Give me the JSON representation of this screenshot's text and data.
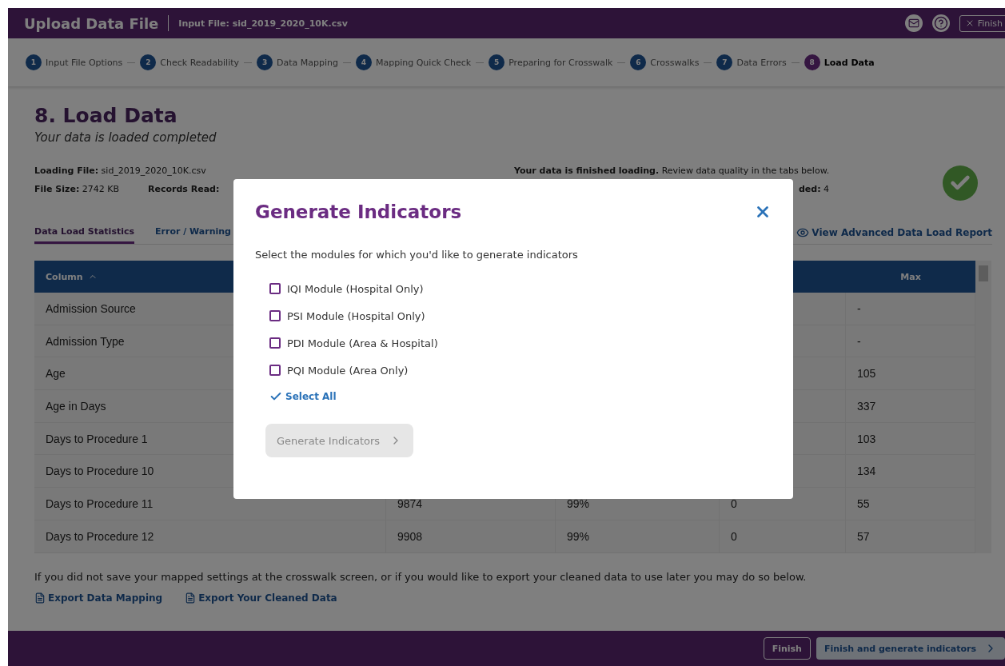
{
  "header": {
    "title": "Upload Data File",
    "input_file": "Input File: sid_2019_2020_10K.csv",
    "finish_button": "Finish"
  },
  "steps": [
    {
      "number": "1",
      "label": "Input File Options",
      "selected": false
    },
    {
      "number": "2",
      "label": "Check Readability",
      "selected": false
    },
    {
      "number": "3",
      "label": "Data Mapping",
      "selected": false
    },
    {
      "number": "4",
      "label": "Mapping Quick Check",
      "selected": false
    },
    {
      "number": "5",
      "label": "Preparing for Crosswalk",
      "selected": false
    },
    {
      "number": "6",
      "label": "Crosswalks",
      "selected": false
    },
    {
      "number": "7",
      "label": "Data Errors",
      "selected": false
    },
    {
      "number": "8",
      "label": "Load Data",
      "selected": true
    }
  ],
  "page": {
    "title": "8. Load Data",
    "subtitle": "Your data is loaded completed",
    "loading_file": "**Loading File:** sid_2019_2020_10K.csv",
    "file_size": "**File Size:** 2742 KB",
    "records_read": "**Records Read:**",
    "status_message": "**Your data is finished loading.** Review data quality in the tabs below.",
    "status_count": "**ded:** 4"
  },
  "tabs": [
    {
      "label": "Data Load Statistics",
      "selected": true
    },
    {
      "label": "Error / Warning",
      "selected": false
    }
  ],
  "report_link": "View Advanced Data Load Report",
  "table": {
    "columns": [
      {
        "label": "Column",
        "sorted": true
      },
      {
        "label": "Max",
        "sorted": false
      }
    ],
    "rows": [
      {
        "column": "Admission Source",
        "max": "-"
      },
      {
        "column": "Admission Type",
        "max": "-"
      },
      {
        "column": "Age",
        "max": "105"
      },
      {
        "column": "Age in Days",
        "max": "337"
      },
      {
        "column": "Days to Procedure 1",
        "max": "103"
      },
      {
        "column": "Days to Procedure 10",
        "max": "134"
      },
      {
        "column": "Days to Procedure 11",
        "column_2": "9874",
        "column_3": "99%",
        "column_4": "0",
        "max": "55"
      },
      {
        "column": "Days to Procedure 12",
        "column_2": "9908",
        "column_3": "99%",
        "column_4": "0",
        "max": "57"
      }
    ]
  },
  "export_note": "If you did not save your mapped settings at the crosswalk screen, or if you would like to export your cleaned data to use later you may do so below.",
  "export_links": [
    "Export Data Mapping",
    "Export Your Cleaned Data"
  ],
  "footer_buttons": [
    {
      "label": "Finish",
      "kind": "outline"
    },
    {
      "label": "Finish and generate indicators",
      "kind": "next"
    }
  ],
  "modal": {
    "title": "Generate Indicators",
    "description": "Select the modules for which you'd like to generate indicators",
    "modules": [
      {
        "label": "IQI Module (Hospital Only)",
        "checked": false
      },
      {
        "label": "PSI Module (Hospital Only)",
        "checked": false
      },
      {
        "label": "PDI Module (Area & Hospital)",
        "checked": false
      },
      {
        "label": "PQI Module (Area Only)",
        "checked": false
      }
    ],
    "select_all": "Select All",
    "button": {
      "label": "Generate Indicators",
      "disabled": true
    }
  }
}
